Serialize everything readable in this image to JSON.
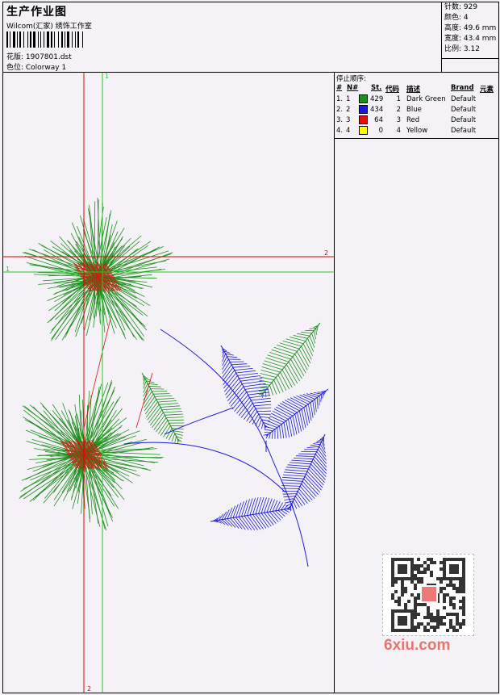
{
  "header": {
    "title": "生产作业图",
    "studio": "Wilcom(汇家) 绣饰工作室",
    "pattern_label": "花版: 1907801.dst",
    "colorway_label": "色位: Colorway 1"
  },
  "stats": {
    "stitches": "针数: 929",
    "colors": "颜色: 4",
    "height": "高度: 49.6 mm",
    "width": "宽度: 43.4 mm",
    "scale": "比例: 3.12"
  },
  "stop_sequence": {
    "title": "停止顺序:",
    "headers": {
      "num": "#",
      "needle": "N#",
      "stitches": "St.",
      "code": "代码",
      "desc": "描述",
      "brand": "Brand",
      "element": "元素"
    },
    "rows": [
      {
        "num": "1.",
        "needle": "1",
        "color": "#1e8f1e",
        "stitches": "429",
        "code": "1",
        "desc": "Dark Green",
        "brand": "Default"
      },
      {
        "num": "2.",
        "needle": "2",
        "color": "#1a1ad8",
        "stitches": "434",
        "code": "2",
        "desc": "Blue",
        "brand": "Default"
      },
      {
        "num": "3.",
        "needle": "3",
        "color": "#e01010",
        "stitches": "64",
        "code": "3",
        "desc": "Red",
        "brand": "Default"
      },
      {
        "num": "4.",
        "needle": "4",
        "color": "#ffff00",
        "stitches": "0",
        "code": "4",
        "desc": "Yellow",
        "brand": "Default"
      }
    ]
  },
  "axes": {
    "green_label_top": "1",
    "green_label_left": "1",
    "red_label_right": "2",
    "red_label_bottom": "2"
  },
  "colors": {
    "green": "#1e8f1e",
    "blue": "#1a1ad8",
    "red": "#e01010",
    "axis_green": "#22cc22",
    "axis_red": "#e00000"
  },
  "watermark": "6xiu.com",
  "qr_icon": "qr-code-icon"
}
